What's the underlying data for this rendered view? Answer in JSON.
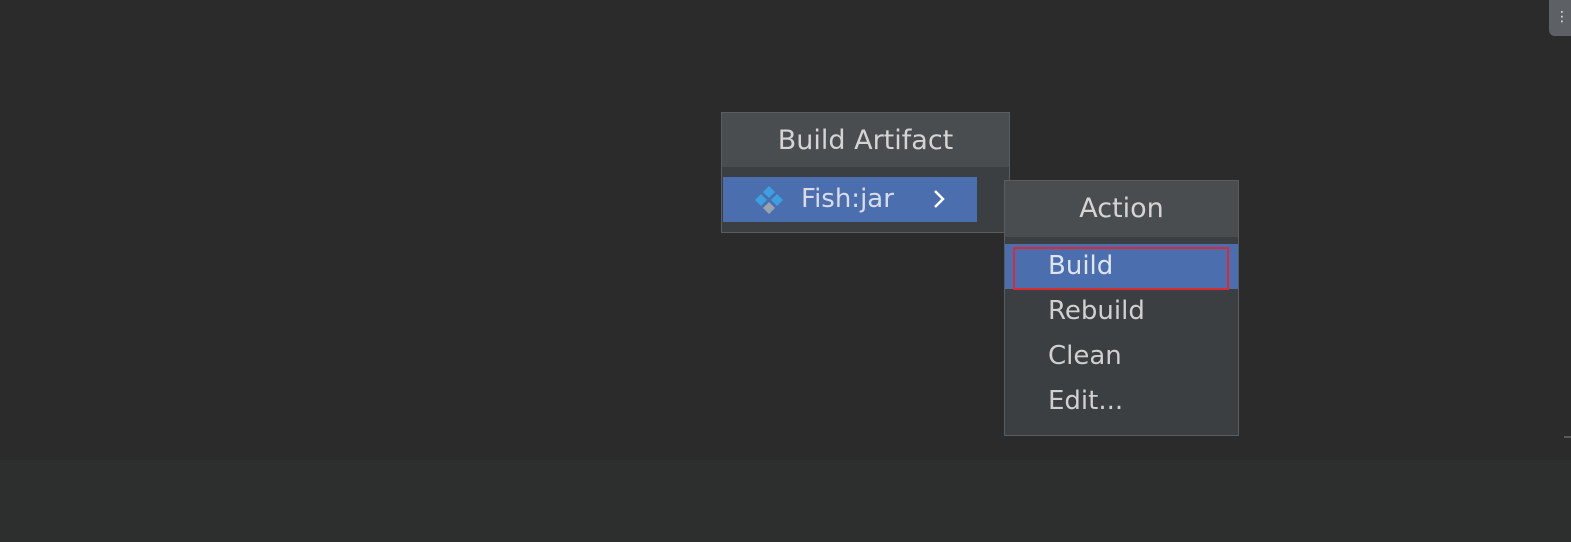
{
  "corner_button": {
    "label": "⋮",
    "icon": "more-dots-icon"
  },
  "artifact_popup": {
    "title": "Build Artifact",
    "items": [
      {
        "label": "Fish:jar",
        "icon": "artifact-diamond-icon",
        "submenu_icon": "chevron-right-icon",
        "selected": true
      }
    ]
  },
  "action_popup": {
    "title": "Action",
    "items": [
      {
        "label": "Build",
        "selected": true,
        "highlighted_outline": true
      },
      {
        "label": "Rebuild",
        "selected": false
      },
      {
        "label": "Clean",
        "selected": false
      },
      {
        "label": "Edit...",
        "selected": false
      }
    ]
  },
  "colors": {
    "background": "#2b2b2b",
    "popup_bg": "#3c3f41",
    "popup_header": "#4a4d50",
    "selection": "#4b6eaf",
    "highlight_outline": "#d92b36",
    "artifact_icon": "#3d9fdf"
  }
}
